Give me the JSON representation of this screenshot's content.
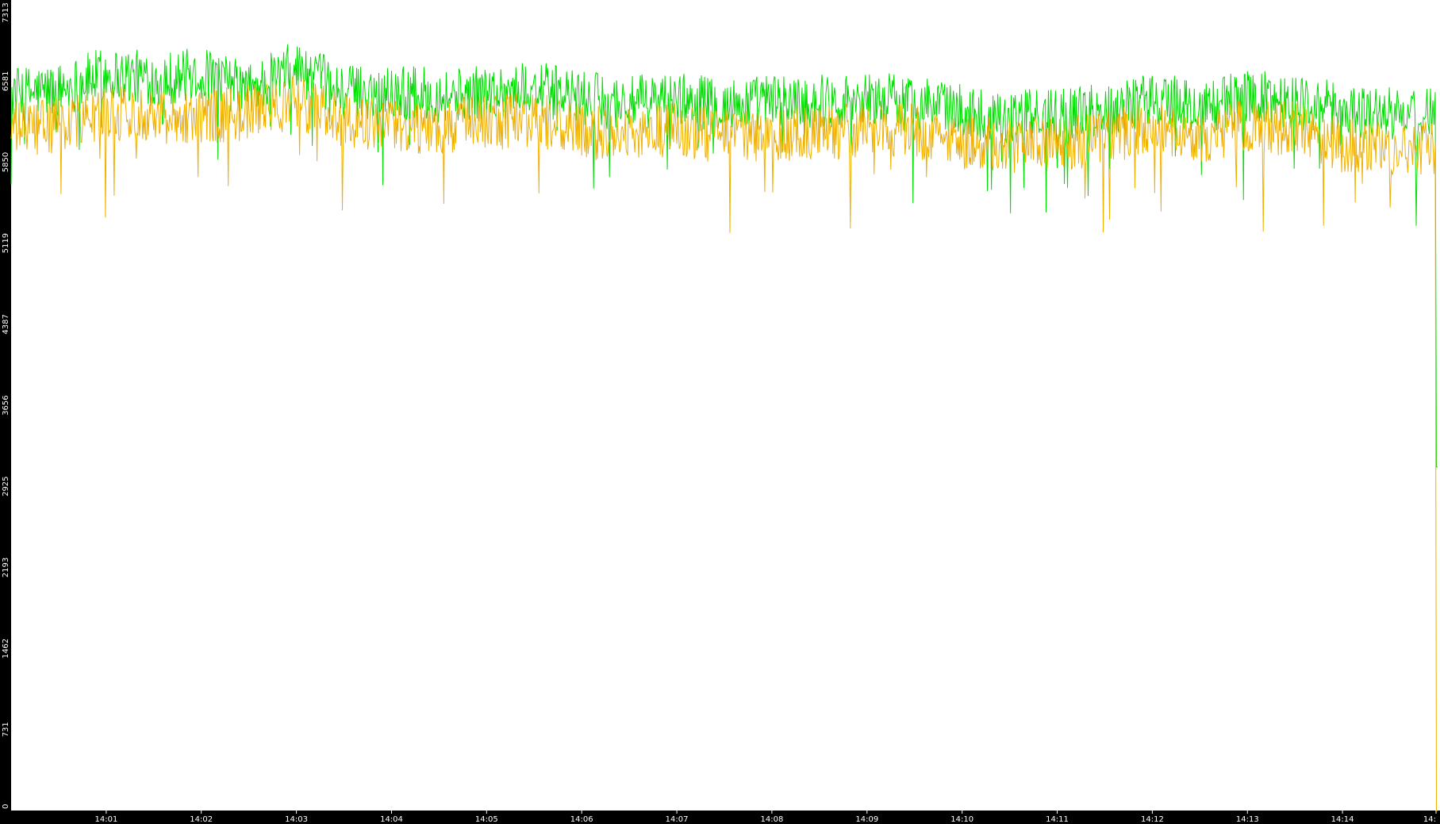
{
  "chart_data": {
    "type": "line",
    "title": "",
    "xlabel": "",
    "ylabel": "",
    "x_unit": "minutes",
    "xlim": [
      13.0,
      27.0
    ],
    "ylim": [
      0,
      7313
    ],
    "y_ticks": [
      0,
      731,
      1462,
      2193,
      2925,
      3656,
      4387,
      5119,
      5850,
      6581,
      7313
    ],
    "y_tick_labels": [
      "0",
      "731",
      "1462",
      "2193",
      "2925",
      "3656",
      "4387",
      "5119",
      "5850",
      "6581",
      "7313"
    ],
    "x_ticks": [
      14.01,
      14.02,
      14.03,
      14.04,
      14.05,
      14.06,
      14.07,
      14.08,
      14.09,
      14.1,
      14.11,
      14.12,
      14.13,
      14.14
    ],
    "x_tick_labels": [
      "14:01",
      "14:02",
      "14:03",
      "14:04",
      "14:05",
      "14:06",
      "14:07",
      "14:08",
      "14:09",
      "14:10",
      "14:11",
      "14:12",
      "14:13",
      "14:14",
      "14:"
    ],
    "grid": false,
    "legend": "none",
    "series": [
      {
        "color": "#00dd00",
        "x": [
          14.0,
          14.005,
          14.01,
          14.015,
          14.02,
          14.025,
          14.03,
          14.035,
          14.04,
          14.045,
          14.05,
          14.055,
          14.06,
          14.065,
          14.07,
          14.075,
          14.08,
          14.085,
          14.09,
          14.095,
          14.1,
          14.105,
          14.11,
          14.115,
          14.12,
          14.125,
          14.13,
          14.135,
          14.14,
          14.145,
          14.15
        ],
        "y": [
          6460,
          6500,
          6650,
          6600,
          6640,
          6500,
          6700,
          6480,
          6490,
          6450,
          6470,
          6520,
          6420,
          6380,
          6420,
          6360,
          6400,
          6400,
          6420,
          6400,
          6300,
          6250,
          6280,
          6320,
          6430,
          6330,
          6440,
          6400,
          6320,
          6280,
          3100
        ]
      },
      {
        "color": "#f0b000",
        "x": [
          14.0,
          14.005,
          14.01,
          14.015,
          14.02,
          14.025,
          14.03,
          14.035,
          14.04,
          14.045,
          14.05,
          14.055,
          14.06,
          14.065,
          14.07,
          14.075,
          14.08,
          14.085,
          14.09,
          14.095,
          14.1,
          14.105,
          14.11,
          14.115,
          14.12,
          14.125,
          14.13,
          14.135,
          14.14,
          14.145,
          14.15
        ],
        "y": [
          6150,
          6180,
          6280,
          6300,
          6250,
          6300,
          6400,
          6230,
          6160,
          6180,
          6200,
          6240,
          6120,
          6100,
          6150,
          6080,
          6100,
          6100,
          6150,
          6130,
          6030,
          5980,
          6010,
          6060,
          6200,
          6080,
          6180,
          6150,
          6000,
          5980,
          0
        ]
      }
    ]
  }
}
